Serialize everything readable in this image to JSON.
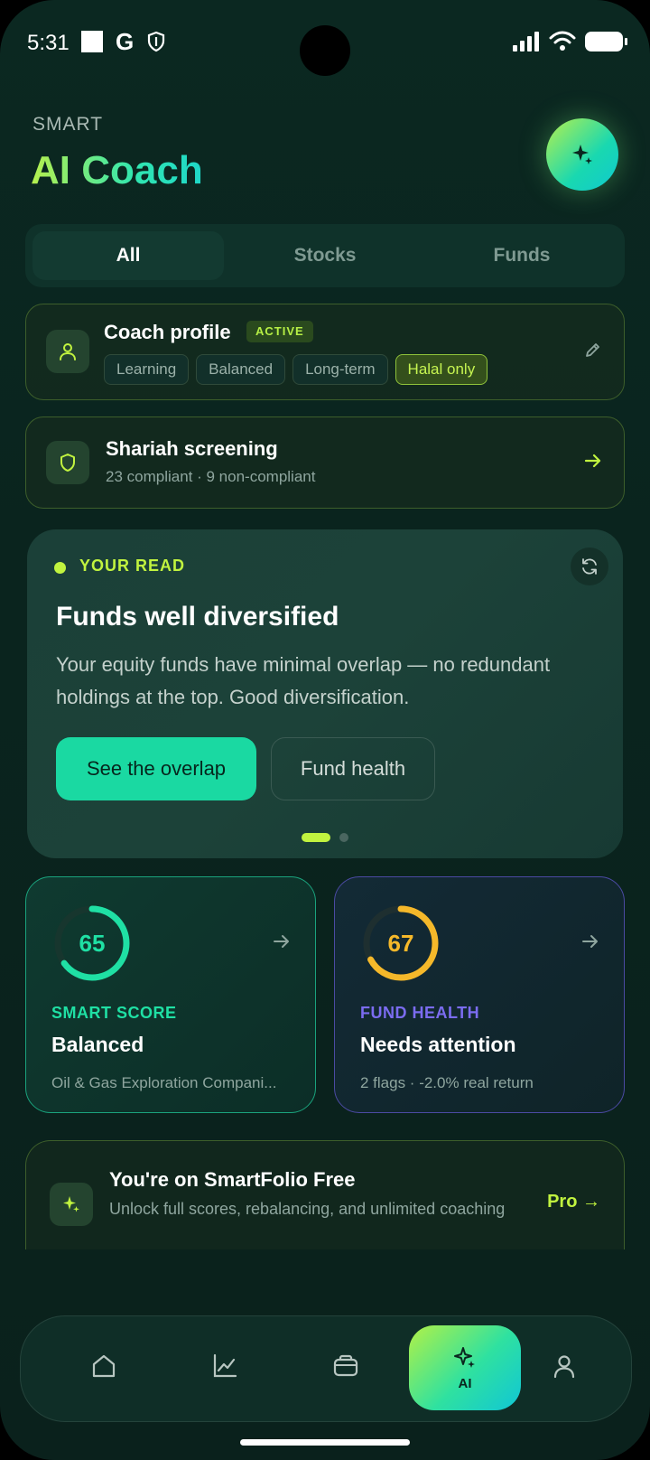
{
  "status_bar": {
    "time": "5:31",
    "g_label": "G"
  },
  "header": {
    "eyebrow": "SMART",
    "title": "AI Coach",
    "fab_icon": "sparkle-icon"
  },
  "tabs": [
    {
      "label": "All",
      "active": true
    },
    {
      "label": "Stocks",
      "active": false
    },
    {
      "label": "Funds",
      "active": false
    }
  ],
  "coach_profile": {
    "title": "Coach profile",
    "badge": "ACTIVE",
    "chips": [
      "Learning",
      "Balanced",
      "Long-term",
      "Halal only"
    ],
    "icon": "user-icon",
    "edit_icon": "pencil-icon"
  },
  "shariah": {
    "title": "Shariah screening",
    "subtitle": "23 compliant · 9 non-compliant",
    "icon": "shield-icon"
  },
  "your_read": {
    "label": "YOUR READ",
    "title": "Funds well diversified",
    "body": "Your equity funds have minimal overlap — no redundant holdings at the top. Good diversification.",
    "primary_button": "See the overlap",
    "secondary_button": "Fund health",
    "pager_count": 2,
    "pager_active": 0
  },
  "smart_score": {
    "value": "65",
    "progress": 0.65,
    "label": "SMART SCORE",
    "title": "Balanced",
    "subtitle": "Oil & Gas Exploration Compani...",
    "color": "#1fe0a4"
  },
  "fund_health": {
    "value": "67",
    "progress": 0.67,
    "label": "FUND HEALTH",
    "title": "Needs attention",
    "subtitle": "2 flags · -2.0% real return",
    "color": "#f5b82a",
    "label_color": "#7b6cf0"
  },
  "upgrade": {
    "title": "You're on SmartFolio Free",
    "subtitle": "Unlock full scores, rebalancing, and unlimited coaching",
    "cta": "Pro →"
  },
  "nav": {
    "items": [
      "home-icon",
      "chart-icon",
      "wallet-icon",
      "sparkle-icon",
      "profile-icon"
    ],
    "ai_label": "AI",
    "active": "AI"
  },
  "colors": {
    "accent": "#c1f33f",
    "primary": "#1ad9a2",
    "background": "#0a241e"
  }
}
